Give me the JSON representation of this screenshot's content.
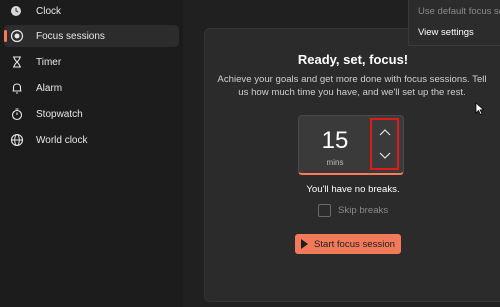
{
  "app": {
    "title": "Clock"
  },
  "sidebar": {
    "items": [
      {
        "label": "Focus sessions",
        "icon": "focus-icon",
        "selected": true
      },
      {
        "label": "Timer",
        "icon": "hourglass-icon"
      },
      {
        "label": "Alarm",
        "icon": "bell-icon"
      },
      {
        "label": "Stopwatch",
        "icon": "stopwatch-icon"
      },
      {
        "label": "World clock",
        "icon": "globe-icon"
      }
    ]
  },
  "menu": {
    "items": [
      {
        "label": "Use default focus se",
        "disabled": true
      },
      {
        "label": "View settings",
        "disabled": false
      }
    ]
  },
  "focus": {
    "title": "Ready, set, focus!",
    "description": "Achieve your goals and get more done with focus sessions. Tell us how much time you have, and we'll set up the rest.",
    "minutes": "15",
    "unit": "mins",
    "breaks_text": "You'll have no breaks.",
    "skip_breaks_label": "Skip breaks",
    "skip_breaks_checked": false,
    "start_label": "Start focus session"
  },
  "colors": {
    "accent": "#ff7a59",
    "highlight_border": "#e01919",
    "background": "#202020",
    "card": "#2b2b2b"
  }
}
